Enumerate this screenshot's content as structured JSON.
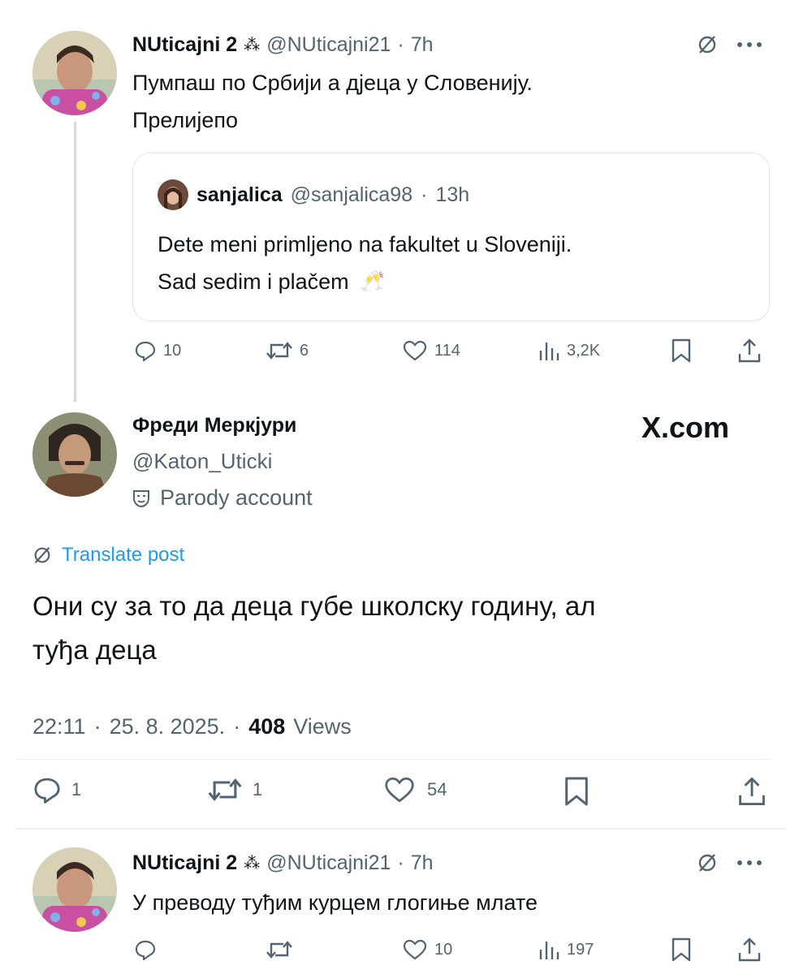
{
  "tweet1": {
    "author_name": "NUticajni 2",
    "badge_glyph": "⁂",
    "handle": "@NUticajni21",
    "separator": "·",
    "time": "7h",
    "text_line1": "Пумпаш по Србији а дјеца у Словенију.",
    "text_line2": "Прелијепо",
    "quote": {
      "author_name": "sanjalica",
      "handle": "@sanjalica98",
      "separator": "·",
      "time": "13h",
      "text_line1": "Dete meni primljeno na fakultet u Sloveniji.",
      "text_line2": "Sad sedim i plačem",
      "emoji": "🥂"
    },
    "actions": {
      "replies": "10",
      "reposts": "6",
      "likes": "114",
      "views": "3,2K"
    }
  },
  "tweet2": {
    "author_name": "Фреди Меркјури",
    "handle": "@Katon_Uticki",
    "parody_label": "Parody account",
    "brand": "X.com",
    "translate_label": "Translate post",
    "text_line1": "Они су за то да деца губе школску годину, ал",
    "text_line2": "туђа деца",
    "meta": {
      "time": "22:11",
      "sep1": "·",
      "date": "25. 8. 2025.",
      "sep2": "·",
      "views_count": "408",
      "views_label": "Views"
    },
    "actions": {
      "replies": "1",
      "reposts": "1",
      "likes": "54"
    }
  },
  "tweet3": {
    "author_name": "NUticajni 2",
    "badge_glyph": "⁂",
    "handle": "@NUticajni21",
    "separator": "·",
    "time": "7h",
    "text": "У преводу туђим курцем глогиње млате",
    "actions": {
      "likes": "10",
      "views": "197"
    }
  },
  "colors": {
    "text": "#0f1419",
    "muted": "#536471",
    "link": "#1d9bf0",
    "border": "#dfe5e9"
  }
}
